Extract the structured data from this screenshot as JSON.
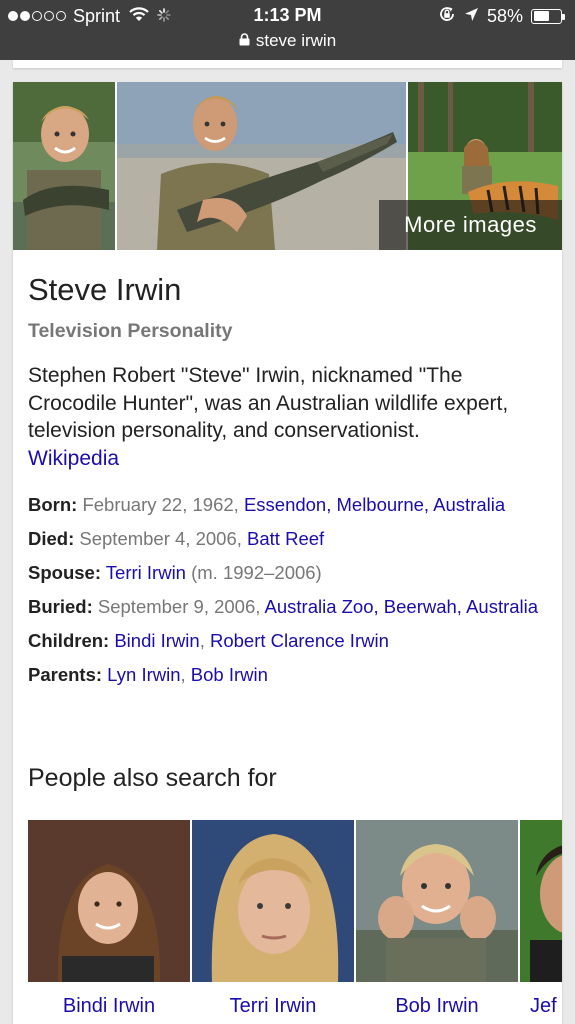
{
  "status_bar": {
    "carrier": "Sprint",
    "time": "1:13 PM",
    "battery_percent": "58%",
    "battery_level": 0.58,
    "url": "steve irwin",
    "icons": [
      "signal-dots-icon",
      "wifi-icon",
      "spinner-icon",
      "rotation-lock-icon",
      "location-arrow-icon",
      "battery-icon",
      "lock-icon"
    ]
  },
  "images": {
    "more_images_label": "More images"
  },
  "entity": {
    "name": "Steve Irwin",
    "subtitle": "Television Personality",
    "description": "Stephen Robert \"Steve\" Irwin, nicknamed \"The Crocodile Hunter\", was an Australian wildlife expert, television personality, and conservationist.",
    "source_link": "Wikipedia"
  },
  "facts": {
    "born": {
      "label": "Born:",
      "date": "February 22, 1962,",
      "place": "Essendon, Melbourne, Australia"
    },
    "died": {
      "label": "Died:",
      "date": "September 4, 2006,",
      "place": "Batt Reef"
    },
    "spouse": {
      "label": "Spouse:",
      "name": "Terri Irwin",
      "note": "(m. 1992–2006)"
    },
    "buried": {
      "label": "Buried:",
      "date": "September 9, 2006,",
      "place": "Australia Zoo, Beerwah, Australia"
    },
    "children": {
      "label": "Children:",
      "first": "Bindi Irwin",
      "sep": ",",
      "second": "Robert Clarence Irwin"
    },
    "parents": {
      "label": "Parents:",
      "first": "Lyn Irwin",
      "sep": ",",
      "second": "Bob Irwin"
    }
  },
  "people_also_search": {
    "title": "People also search for",
    "people": [
      {
        "name": "Bindi Irwin"
      },
      {
        "name": "Terri Irwin"
      },
      {
        "name": "Bob Irwin"
      },
      {
        "name": "Jef"
      }
    ]
  },
  "colors": {
    "status_bar_bg": "#3f3f3f",
    "link": "#1a0dab",
    "muted_text": "#777777",
    "page_bg": "#e9e9e9"
  }
}
